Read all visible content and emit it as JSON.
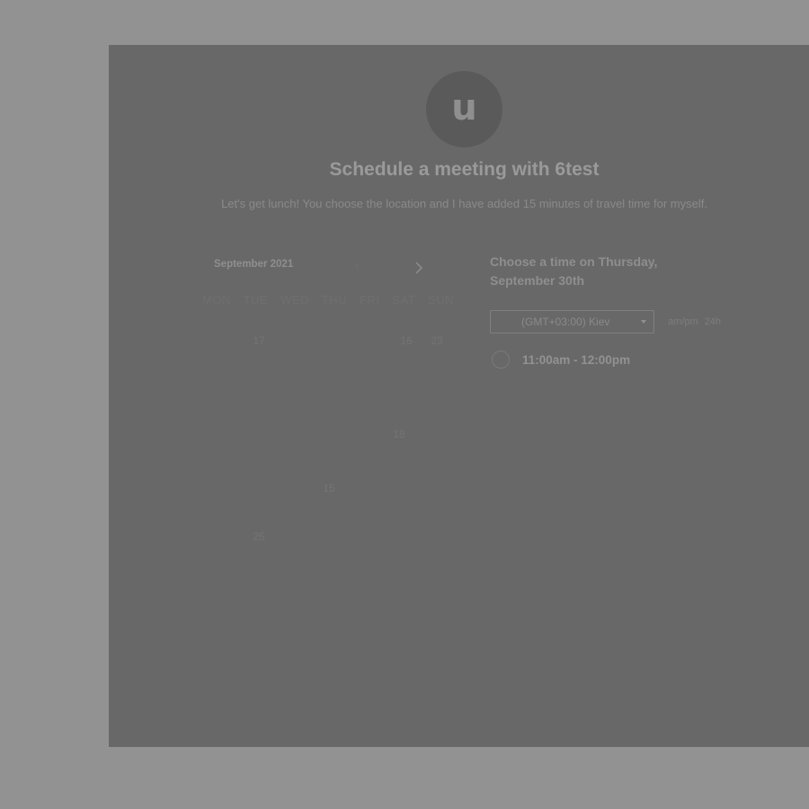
{
  "avatar": {
    "letter": "u"
  },
  "title": "Schedule a meeting with 6test",
  "description": "Let's get lunch! You choose the location and I have added 15 minutes of travel time for myself.",
  "calendar": {
    "month_label": "September 2021",
    "prev_icon": "chevron-left-icon",
    "next_icon": "chevron-right-icon",
    "weekdays": [
      "MON",
      "TUE",
      "WED",
      "THU",
      "FRI",
      "SAT",
      "SUN"
    ],
    "visible_days": [
      "17",
      "16",
      "23",
      "18",
      "15",
      "25"
    ]
  },
  "time_picker": {
    "heading": "Choose a time on Thursday, September 30th",
    "timezone": "(GMT+03:00) Kiev",
    "format_ampm": "am/pm",
    "format_24h": "24h",
    "slots": [
      {
        "label": "11:00am - 12:00pm"
      }
    ]
  }
}
